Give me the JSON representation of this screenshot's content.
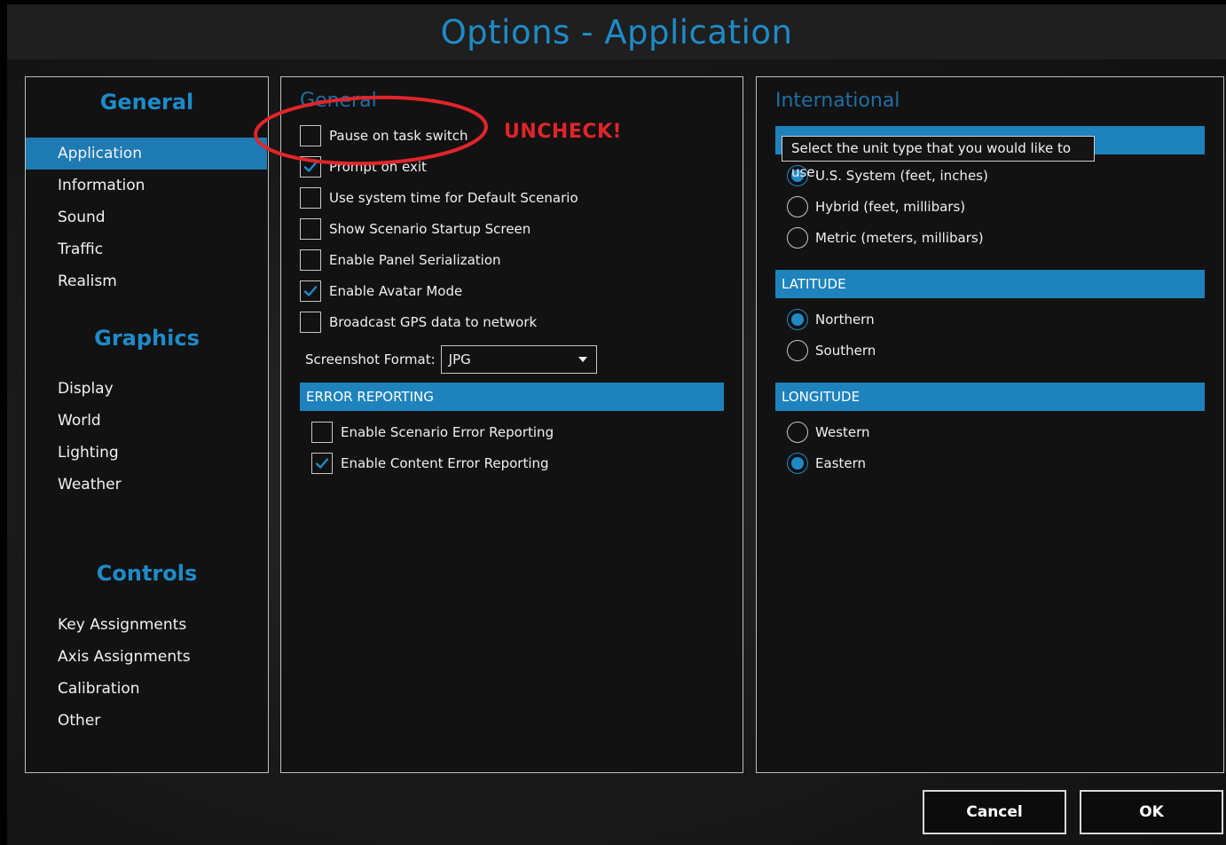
{
  "window": {
    "title": "Options - Application"
  },
  "sidebar": {
    "groups": [
      {
        "header": "General",
        "items": [
          "Application",
          "Information",
          "Sound",
          "Traffic",
          "Realism"
        ],
        "selected": "Application"
      },
      {
        "header": "Graphics",
        "items": [
          "Display",
          "World",
          "Lighting",
          "Weather"
        ]
      },
      {
        "header": "Controls",
        "items": [
          "Key Assignments",
          "Axis Assignments",
          "Calibration",
          "Other"
        ]
      }
    ]
  },
  "general": {
    "title": "General",
    "options": [
      {
        "label": "Pause on task switch",
        "checked": false
      },
      {
        "label": "Prompt on exit",
        "checked": true
      },
      {
        "label": "Use system time for Default Scenario",
        "checked": false
      },
      {
        "label": "Show Scenario Startup Screen",
        "checked": false
      },
      {
        "label": "Enable Panel Serialization",
        "checked": false
      },
      {
        "label": "Enable Avatar Mode",
        "checked": true
      },
      {
        "label": "Broadcast GPS data to network",
        "checked": false
      }
    ],
    "screenshot_format": {
      "label": "Screenshot Format:",
      "value": "JPG"
    },
    "error_reporting": {
      "header": "ERROR REPORTING",
      "options": [
        {
          "label": "Enable Scenario Error Reporting",
          "checked": false
        },
        {
          "label": "Enable Content Error Reporting",
          "checked": true
        }
      ]
    }
  },
  "international": {
    "title": "International",
    "tooltip": "Select the unit type that you would like to use.",
    "units": [
      {
        "label": "U.S. System (feet, inches)",
        "selected": true
      },
      {
        "label": "Hybrid (feet, millibars)",
        "selected": false
      },
      {
        "label": "Metric (meters, millibars)",
        "selected": false
      }
    ],
    "latitude": {
      "header": "LATITUDE",
      "options": [
        {
          "label": "Northern",
          "selected": true
        },
        {
          "label": "Southern",
          "selected": false
        }
      ]
    },
    "longitude": {
      "header": "LONGITUDE",
      "options": [
        {
          "label": "Western",
          "selected": false
        },
        {
          "label": "Eastern",
          "selected": true
        }
      ]
    }
  },
  "buttons": {
    "cancel": "Cancel",
    "ok": "OK"
  },
  "annotation": {
    "text": "UNCHECK!",
    "color": "#e1252a"
  },
  "colors": {
    "accent": "#1e8bc8",
    "bar": "#1e82bd"
  }
}
